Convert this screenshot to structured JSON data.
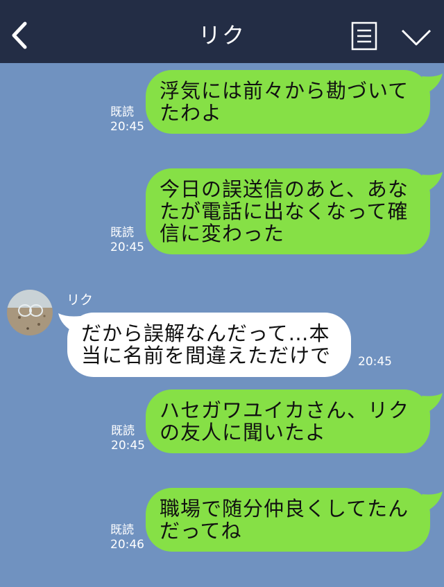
{
  "header": {
    "title": "リク",
    "back_icon": "chevron-left-icon",
    "menu_icon": "document-menu-icon",
    "collapse_icon": "chevron-down-icon"
  },
  "colors": {
    "header_bg": "#232d45",
    "chat_bg": "#7092c0",
    "outgoing_bubble": "#86e046",
    "incoming_bubble": "#ffffff"
  },
  "messages": [
    {
      "direction": "out",
      "text": "浮気には前々から勘づいて\nたわよ",
      "read_label": "既読",
      "time": "20:45"
    },
    {
      "direction": "out",
      "text": "今日の誤送信のあと、あな\nたが電話に出なくなって確\n信に変わった",
      "read_label": "既読",
      "time": "20:45"
    },
    {
      "direction": "in",
      "sender": "リク",
      "text": "だから誤解なんだって…本\n当に名前を間違えただけで",
      "time": "20:45"
    },
    {
      "direction": "out",
      "text": "ハセガワユイカさん、リク\nの友人に聞いたよ",
      "read_label": "既読",
      "time": "20:45"
    },
    {
      "direction": "out",
      "text": "職場で随分仲良くしてたん\nだってね",
      "read_label": "既読",
      "time": "20:46"
    }
  ]
}
